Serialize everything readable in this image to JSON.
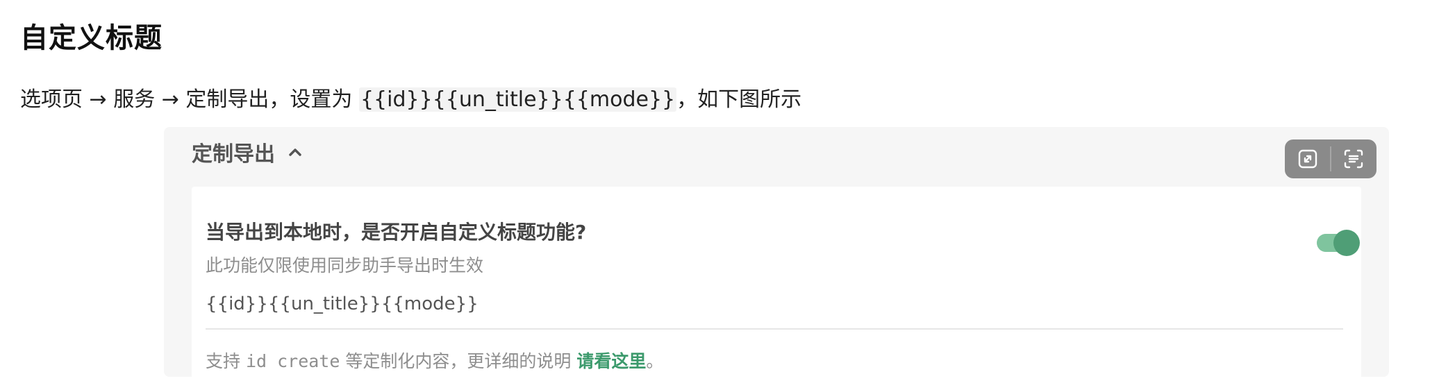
{
  "heading": "自定义标题",
  "intro": {
    "before": "选项页 → 服务 → 定制导出，设置为 ",
    "code": "{{id}}{{un_title}}{{mode}}",
    "after": "，如下图所示"
  },
  "panel": {
    "title": "定制导出",
    "toolbar": {
      "expand_icon": "expand-icon",
      "scan_icon": "scan-text-icon"
    },
    "card": {
      "question": "当导出到本地时，是否开启自定义标题功能?",
      "description": "此功能仅限使用同步助手导出时生效",
      "toggle_on": true,
      "value": "{{id}}{{un_title}}{{mode}}",
      "help": {
        "prefix": "支持 ",
        "code": "id create",
        "middle": " 等定制化内容，更详细的说明 ",
        "link": "请看这里",
        "suffix": "。"
      }
    }
  },
  "colors": {
    "accent": "#3c9a6c",
    "toggle_track": "#7fc49e",
    "toggle_knob": "#4f9e76",
    "toolbar_bg": "#8a8a8a"
  }
}
